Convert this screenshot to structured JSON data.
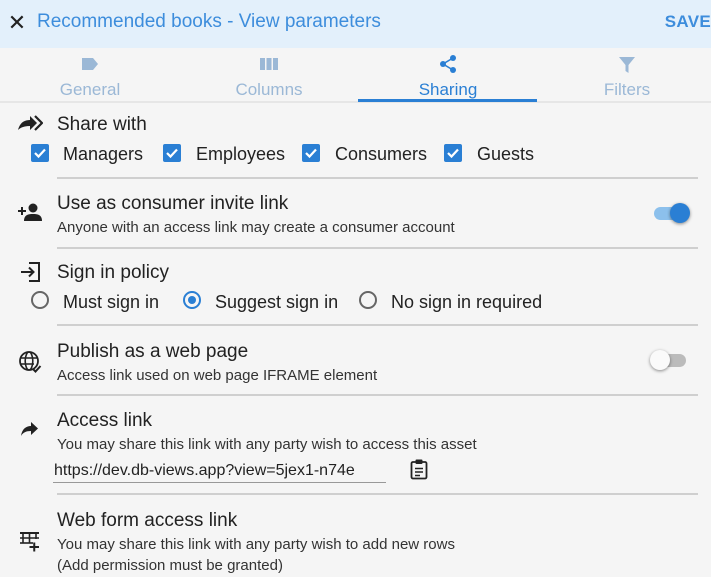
{
  "header": {
    "close_label": "✕",
    "title": "Recommended books - View parameters",
    "save_label": "SAVE"
  },
  "tabs": [
    {
      "label": "General",
      "icon": "label-icon",
      "active": false
    },
    {
      "label": "Columns",
      "icon": "columns-icon",
      "active": false
    },
    {
      "label": "Sharing",
      "icon": "share-icon",
      "active": true
    },
    {
      "label": "Filters",
      "icon": "filter-icon",
      "active": false
    }
  ],
  "share_with": {
    "title": "Share with",
    "icon": "share-arrow-icon",
    "options": [
      {
        "label": "Managers",
        "checked": true
      },
      {
        "label": "Employees",
        "checked": true
      },
      {
        "label": "Consumers",
        "checked": true
      },
      {
        "label": "Guests",
        "checked": true
      }
    ]
  },
  "consumer_invite": {
    "title": "Use as consumer invite link",
    "subtitle": "Anyone with an access link may create a consumer account",
    "icon": "person-add-icon",
    "enabled": true
  },
  "sign_in_policy": {
    "title": "Sign in policy",
    "icon": "login-icon",
    "options": [
      {
        "label": "Must sign in",
        "selected": false
      },
      {
        "label": "Suggest sign in",
        "selected": true
      },
      {
        "label": "No sign in required",
        "selected": false
      }
    ]
  },
  "publish_web": {
    "title": "Publish as a web page",
    "subtitle": "Access link used on web page IFRAME element",
    "icon": "globe-icon",
    "enabled": false
  },
  "access_link": {
    "title": "Access link",
    "subtitle": "You may share this link with any party wish to access this asset",
    "icon": "forward-arrow-icon",
    "url": "https://dev.db-views.app?view=5jex1-n74e"
  },
  "web_form_link": {
    "title": "Web form access link",
    "subtitle": "You may share this link with any party wish to add new rows",
    "subtitle2": "(Add permission must be granted)",
    "icon": "table-add-icon"
  },
  "colors": {
    "accent": "#2a7fd4",
    "header_bg": "#e3f0fb",
    "title_text": "#3d8ddc",
    "inactive_tab": "#9bb8d6"
  }
}
